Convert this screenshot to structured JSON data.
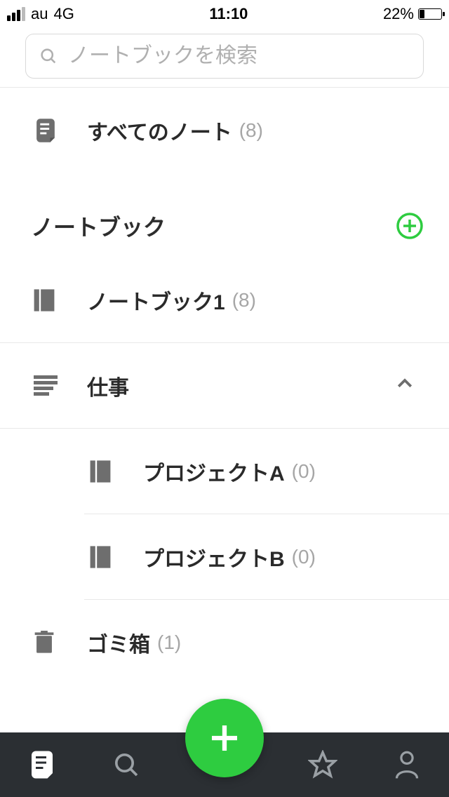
{
  "status": {
    "carrier": "au",
    "network": "4G",
    "time": "11:10",
    "battery_pct": "22%"
  },
  "search": {
    "placeholder": "ノートブックを検索"
  },
  "all_notes": {
    "label": "すべてのノート",
    "count": "(8)"
  },
  "section": {
    "title": "ノートブック"
  },
  "notebooks": [
    {
      "label": "ノートブック1",
      "count": "(8)"
    }
  ],
  "stack": {
    "label": "仕事",
    "expanded": true,
    "children": [
      {
        "label": "プロジェクトA",
        "count": "(0)"
      },
      {
        "label": "プロジェクトB",
        "count": "(0)"
      }
    ]
  },
  "trash": {
    "label": "ゴミ箱",
    "count": "(1)"
  },
  "colors": {
    "accent": "#2ecc40",
    "icon_gray": "#6e6e6e",
    "count_gray": "#a6a6a6"
  }
}
